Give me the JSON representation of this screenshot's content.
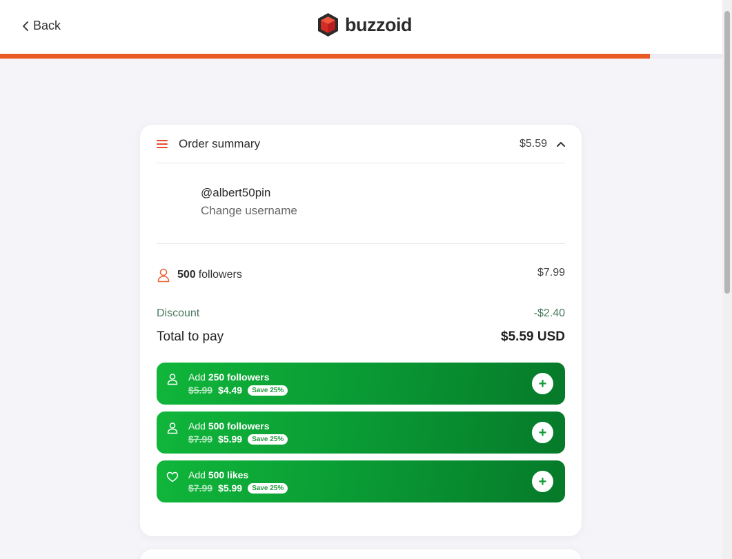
{
  "header": {
    "back_label": "Back",
    "logo_text": "buzzoid",
    "progress_fraction": 0.9,
    "accent_color": "#ea5a25"
  },
  "order_summary": {
    "title": "Order summary",
    "header_price": "$5.59",
    "username": "@albert50pin",
    "change_username": "Change username",
    "item": {
      "icon": "person-icon",
      "quantity": "500",
      "label": "followers",
      "price": "$7.99"
    },
    "discount_label": "Discount",
    "discount_value": "-$2.40",
    "total_label": "Total to pay",
    "total_value": "$5.59 USD"
  },
  "upsells": [
    {
      "icon": "person-icon",
      "prefix": "Add",
      "bold": "250 followers",
      "old_price": "$5.99",
      "new_price": "$4.49",
      "badge": "Save 25%"
    },
    {
      "icon": "person-icon",
      "prefix": "Add",
      "bold": "500 followers",
      "old_price": "$7.99",
      "new_price": "$5.99",
      "badge": "Save 25%"
    },
    {
      "icon": "heart-icon",
      "prefix": "Add",
      "bold": "500 likes",
      "old_price": "$7.99",
      "new_price": "$5.99",
      "badge": "Save 25%"
    }
  ],
  "colors": {
    "upsell_green": "#0a9a34",
    "discount_green": "#4a7a5e",
    "brand_red": "#e23b2e"
  }
}
